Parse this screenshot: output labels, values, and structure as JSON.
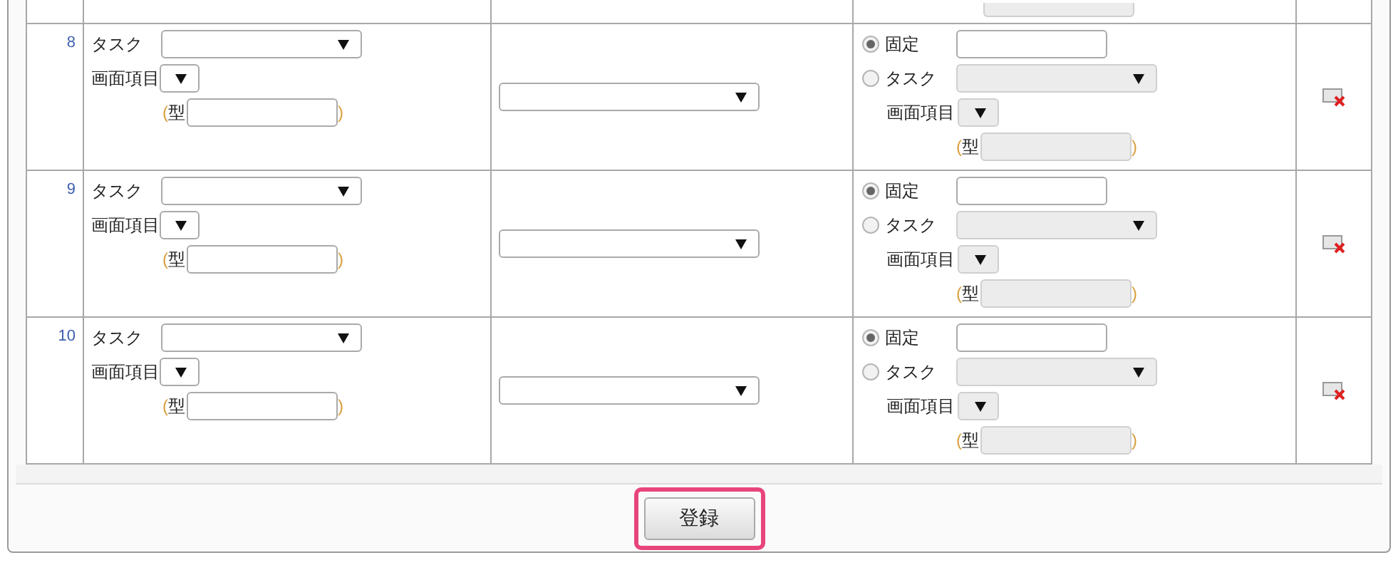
{
  "rows": [
    {
      "number": "8",
      "task_label": "タスク",
      "screen_item_label": "画面項目",
      "type_open": "(",
      "type_label": "型",
      "type_close": ")",
      "value_options": [
        {
          "label": "固定",
          "selected": true
        },
        {
          "label": "タスク",
          "selected": false
        }
      ],
      "value_screen_item_label": "画面項目",
      "value_type_open": "(",
      "value_type_label": "型",
      "value_type_close": ")"
    },
    {
      "number": "9",
      "task_label": "タスク",
      "screen_item_label": "画面項目",
      "type_open": "(",
      "type_label": "型",
      "type_close": ")",
      "value_options": [
        {
          "label": "固定",
          "selected": true
        },
        {
          "label": "タスク",
          "selected": false
        }
      ],
      "value_screen_item_label": "画面項目",
      "value_type_open": "(",
      "value_type_label": "型",
      "value_type_close": ")"
    },
    {
      "number": "10",
      "task_label": "タスク",
      "screen_item_label": "画面項目",
      "type_open": "(",
      "type_label": "型",
      "type_close": ")",
      "value_options": [
        {
          "label": "固定",
          "selected": true
        },
        {
          "label": "タスク",
          "selected": false
        }
      ],
      "value_screen_item_label": "画面項目",
      "value_type_open": "(",
      "value_type_label": "型",
      "value_type_close": ")"
    }
  ],
  "submit_button": "登録"
}
